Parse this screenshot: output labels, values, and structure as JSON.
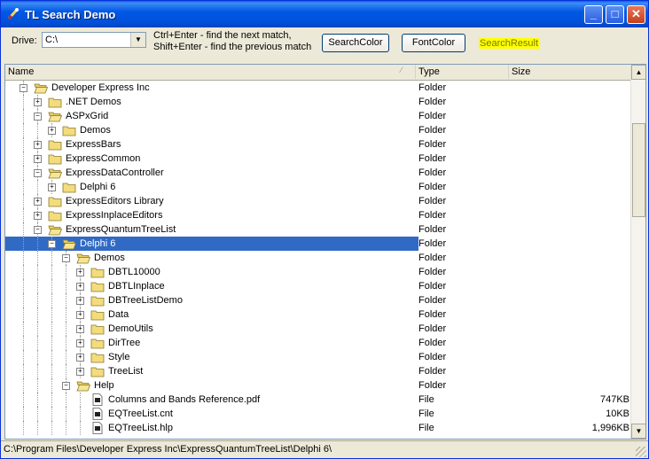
{
  "window": {
    "title": "TL Search Demo"
  },
  "toolbar": {
    "drive_label": "Drive:",
    "drive_value": "C:\\",
    "hint_line1": "Ctrl+Enter - find the next match,",
    "hint_line2": "Shift+Enter - find the previous match",
    "search_color_label": "SearchColor",
    "font_color_label": "FontColor",
    "search_result_label": "SearchResult"
  },
  "grid": {
    "columns": {
      "name": "Name",
      "type": "Type",
      "size": "Size"
    },
    "rows": [
      {
        "level": 0,
        "label": "Developer Express Inc",
        "type": "Folder",
        "size": "",
        "kind": "folder-open",
        "expander": "minus"
      },
      {
        "level": 1,
        "label": ".NET Demos",
        "type": "Folder",
        "size": "",
        "kind": "folder",
        "expander": "plus"
      },
      {
        "level": 1,
        "label": "ASPxGrid",
        "type": "Folder",
        "size": "",
        "kind": "folder-open",
        "expander": "minus"
      },
      {
        "level": 2,
        "label": "Demos",
        "type": "Folder",
        "size": "",
        "kind": "folder",
        "expander": "plus"
      },
      {
        "level": 1,
        "label": "ExpressBars",
        "type": "Folder",
        "size": "",
        "kind": "folder",
        "expander": "plus"
      },
      {
        "level": 1,
        "label": "ExpressCommon",
        "type": "Folder",
        "size": "",
        "kind": "folder",
        "expander": "plus"
      },
      {
        "level": 1,
        "label": "ExpressDataController",
        "type": "Folder",
        "size": "",
        "kind": "folder-open",
        "expander": "minus"
      },
      {
        "level": 2,
        "label": "Delphi 6",
        "type": "Folder",
        "size": "",
        "kind": "folder",
        "expander": "plus"
      },
      {
        "level": 1,
        "label": "ExpressEditors Library",
        "type": "Folder",
        "size": "",
        "kind": "folder",
        "expander": "plus"
      },
      {
        "level": 1,
        "label": "ExpressInplaceEditors",
        "type": "Folder",
        "size": "",
        "kind": "folder",
        "expander": "plus"
      },
      {
        "level": 1,
        "label": "ExpressQuantumTreeList",
        "type": "Folder",
        "size": "",
        "kind": "folder-open",
        "expander": "minus"
      },
      {
        "level": 2,
        "label": "Delphi 6",
        "type": "Folder",
        "size": "",
        "kind": "folder-open",
        "expander": "minus",
        "selected": true
      },
      {
        "level": 3,
        "label": "Demos",
        "type": "Folder",
        "size": "",
        "kind": "folder-open",
        "expander": "minus"
      },
      {
        "level": 4,
        "label": "DBTL10000",
        "type": "Folder",
        "size": "",
        "kind": "folder",
        "expander": "plus"
      },
      {
        "level": 4,
        "label": "DBTLInplace",
        "type": "Folder",
        "size": "",
        "kind": "folder",
        "expander": "plus"
      },
      {
        "level": 4,
        "label": "DBTreeListDemo",
        "type": "Folder",
        "size": "",
        "kind": "folder",
        "expander": "plus"
      },
      {
        "level": 4,
        "label": "Data",
        "type": "Folder",
        "size": "",
        "kind": "folder",
        "expander": "plus"
      },
      {
        "level": 4,
        "label": "DemoUtils",
        "type": "Folder",
        "size": "",
        "kind": "folder",
        "expander": "plus"
      },
      {
        "level": 4,
        "label": "DirTree",
        "type": "Folder",
        "size": "",
        "kind": "folder",
        "expander": "plus"
      },
      {
        "level": 4,
        "label": "Style",
        "type": "Folder",
        "size": "",
        "kind": "folder",
        "expander": "plus"
      },
      {
        "level": 4,
        "label": "TreeList",
        "type": "Folder",
        "size": "",
        "kind": "folder",
        "expander": "plus"
      },
      {
        "level": 3,
        "label": "Help",
        "type": "Folder",
        "size": "",
        "kind": "folder-open",
        "expander": "minus"
      },
      {
        "level": 4,
        "label": "Columns and Bands Reference.pdf",
        "type": "File",
        "size": "747KB",
        "kind": "file",
        "expander": ""
      },
      {
        "level": 4,
        "label": "EQTreeList.cnt",
        "type": "File",
        "size": "10KB",
        "kind": "file",
        "expander": ""
      },
      {
        "level": 4,
        "label": "EQTreeList.hlp",
        "type": "File",
        "size": "1,996KB",
        "kind": "file",
        "expander": ""
      }
    ]
  },
  "status": {
    "path": "C:\\Program Files\\Developer Express Inc\\ExpressQuantumTreeList\\Delphi 6\\"
  }
}
